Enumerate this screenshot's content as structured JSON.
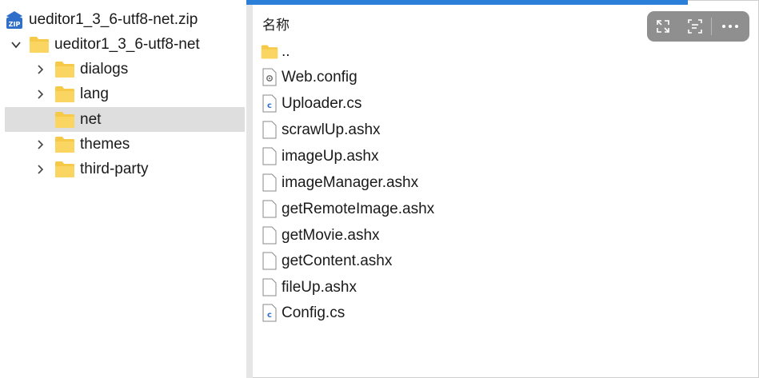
{
  "tree": {
    "root": {
      "label": "ueditor1_3_6-utf8-net.zip",
      "icon": "zip-archive-icon"
    },
    "items": [
      {
        "label": "ueditor1_3_6-utf8-net",
        "expanded": true
      },
      {
        "label": "dialogs",
        "expanded": false
      },
      {
        "label": "lang",
        "expanded": false
      },
      {
        "label": "net",
        "selected": true
      },
      {
        "label": "themes",
        "expanded": false
      },
      {
        "label": "third-party",
        "expanded": false
      }
    ]
  },
  "files": {
    "column_header": "名称",
    "items": [
      {
        "name": "..",
        "icon": "folder-icon"
      },
      {
        "name": "Web.config",
        "icon": "config-file-icon"
      },
      {
        "name": "Uploader.cs",
        "icon": "csharp-file-icon"
      },
      {
        "name": "scrawlUp.ashx",
        "icon": "blank-file-icon"
      },
      {
        "name": "imageUp.ashx",
        "icon": "blank-file-icon"
      },
      {
        "name": "imageManager.ashx",
        "icon": "blank-file-icon"
      },
      {
        "name": "getRemoteImage.ashx",
        "icon": "blank-file-icon"
      },
      {
        "name": "getMovie.ashx",
        "icon": "blank-file-icon"
      },
      {
        "name": "getContent.ashx",
        "icon": "blank-file-icon"
      },
      {
        "name": "fileUp.ashx",
        "icon": "blank-file-icon"
      },
      {
        "name": "Config.cs",
        "icon": "csharp-file-icon"
      }
    ]
  },
  "toolbar": {
    "buttons": [
      "expand-icon",
      "scan-text-icon",
      "more-icon"
    ]
  },
  "colors": {
    "accent": "#2b7fd8",
    "folder": "#f7c948",
    "selected_row": "#dedede",
    "toolbar_bg": "#8f8f8f"
  }
}
